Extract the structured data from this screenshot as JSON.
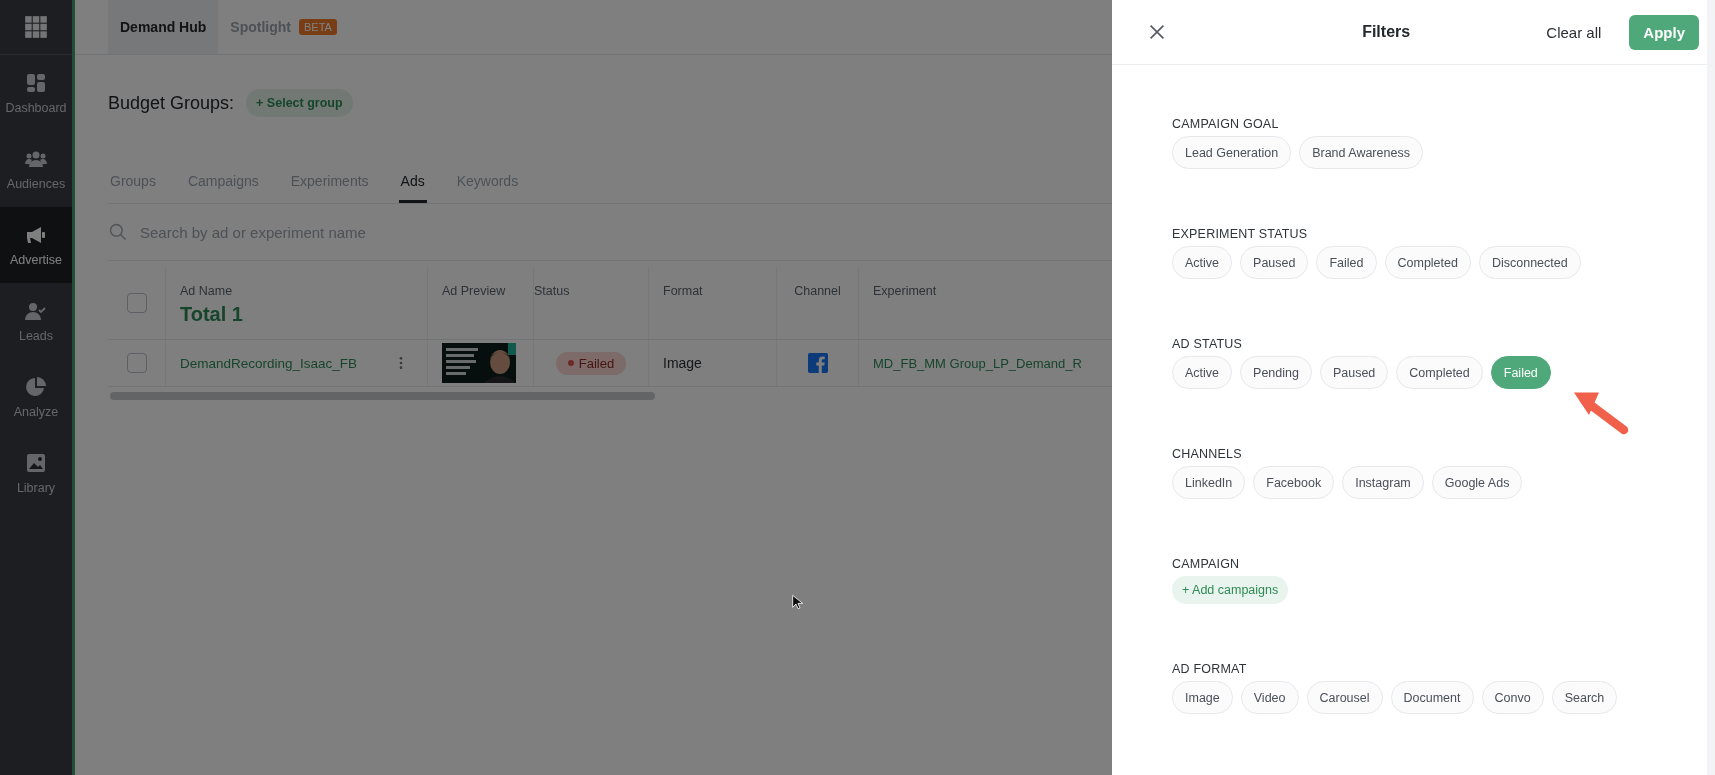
{
  "sidebar": {
    "items": [
      {
        "label": "Dashboard",
        "selected": false
      },
      {
        "label": "Audiences",
        "selected": false
      },
      {
        "label": "Advertise",
        "selected": true
      },
      {
        "label": "Leads",
        "selected": false
      },
      {
        "label": "Analyze",
        "selected": false
      },
      {
        "label": "Library",
        "selected": false
      }
    ]
  },
  "top_tabs": [
    {
      "label": "Demand Hub",
      "selected": true
    },
    {
      "label": "Spotlight",
      "badge": "BETA",
      "selected": false
    }
  ],
  "budget_groups": {
    "label": "Budget Groups:",
    "button": "+ Select group"
  },
  "tabs": [
    {
      "label": "Groups",
      "selected": false
    },
    {
      "label": "Campaigns",
      "selected": false
    },
    {
      "label": "Experiments",
      "selected": false
    },
    {
      "label": "Ads",
      "selected": true
    },
    {
      "label": "Keywords",
      "selected": false
    }
  ],
  "search": {
    "placeholder": "Search by ad or experiment name"
  },
  "table": {
    "columns": [
      "Ad Name",
      "Ad Preview",
      "Status",
      "Format",
      "Channel",
      "Experiment"
    ],
    "total": "Total 1",
    "header_checked": false,
    "rows": [
      {
        "checked": false,
        "ad_name": "DemandRecording_Isaac_FB",
        "status": "Failed",
        "format": "Image",
        "experiment": "MD_FB_MM Group_LP_Demand_R"
      }
    ]
  },
  "filters": {
    "title": "Filters",
    "clear": "Clear all",
    "apply": "Apply",
    "sections": [
      {
        "label": "CAMPAIGN GOAL",
        "kind": "chips",
        "options": [
          {
            "label": "Lead Generation",
            "selected": false
          },
          {
            "label": "Brand Awareness",
            "selected": false
          }
        ]
      },
      {
        "label": "EXPERIMENT STATUS",
        "kind": "chips",
        "options": [
          {
            "label": "Active",
            "selected": false
          },
          {
            "label": "Paused",
            "selected": false
          },
          {
            "label": "Failed",
            "selected": false
          },
          {
            "label": "Completed",
            "selected": false
          },
          {
            "label": "Disconnected",
            "selected": false
          }
        ]
      },
      {
        "label": "AD STATUS",
        "kind": "chips",
        "options": [
          {
            "label": "Active",
            "selected": false
          },
          {
            "label": "Pending",
            "selected": false
          },
          {
            "label": "Paused",
            "selected": false
          },
          {
            "label": "Completed",
            "selected": false
          },
          {
            "label": "Failed",
            "selected": true
          }
        ]
      },
      {
        "label": "CHANNELS",
        "kind": "chips",
        "options": [
          {
            "label": "LinkedIn",
            "selected": false
          },
          {
            "label": "Facebook",
            "selected": false
          },
          {
            "label": "Instagram",
            "selected": false
          },
          {
            "label": "Google Ads",
            "selected": false
          }
        ]
      },
      {
        "label": "CAMPAIGN",
        "kind": "add",
        "button": "+ Add campaigns"
      },
      {
        "label": "AD FORMAT",
        "kind": "chips",
        "options": [
          {
            "label": "Image",
            "selected": false
          },
          {
            "label": "Video",
            "selected": false
          },
          {
            "label": "Carousel",
            "selected": false
          },
          {
            "label": "Document",
            "selected": false
          },
          {
            "label": "Convo",
            "selected": false
          },
          {
            "label": "Search",
            "selected": false
          }
        ]
      }
    ]
  }
}
